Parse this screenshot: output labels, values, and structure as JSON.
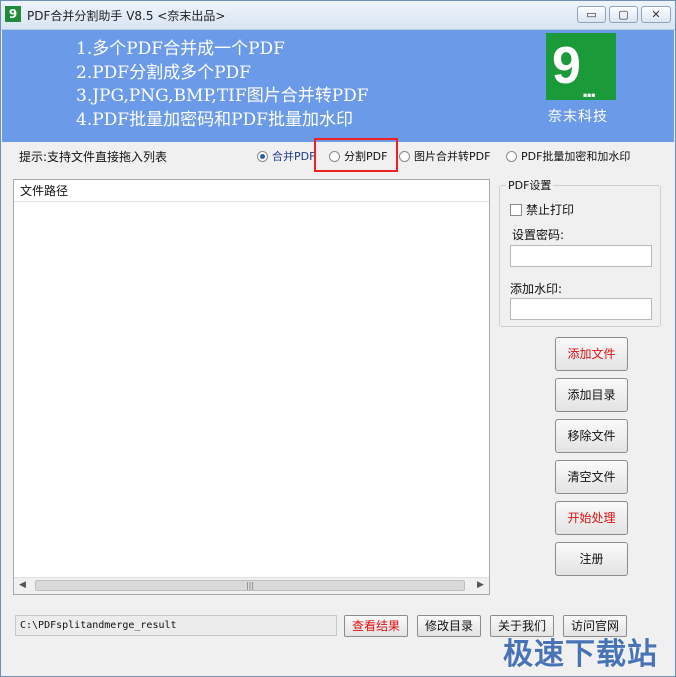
{
  "window": {
    "title": "PDF合并分割助手 V8.5 <奈末出品>",
    "app_icon_glyph": "9",
    "controls": {
      "minimize": "▭",
      "restore": "▢",
      "close": "✕"
    }
  },
  "banner": {
    "features": [
      "1.多个PDF合并成一个PDF",
      "2.PDF分割成多个PDF",
      "3.JPG,PNG,BMP,TIF图片合并转PDF",
      "4.PDF批量加密码和PDF批量加水印"
    ],
    "logo_glyph": "9",
    "logo_dots": "...",
    "brand": "奈末科技",
    "background_color": "#6b9be8",
    "logo_color": "#1b9a3a"
  },
  "hint": "提示:支持文件直接拖入列表",
  "modes": [
    {
      "label": "合并PDF",
      "selected": true
    },
    {
      "label": "分割PDF",
      "selected": false
    },
    {
      "label": "图片合并转PDF",
      "selected": false
    },
    {
      "label": "PDF批量加密和加水印",
      "selected": false
    }
  ],
  "file_list": {
    "column_header": "文件路径",
    "rows": [],
    "scroll_left": "◀",
    "scroll_right": "▶",
    "scroll_grip": "|||"
  },
  "pdf_settings": {
    "legend": "PDF设置",
    "no_print_label": "禁止打印",
    "no_print_checked": false,
    "password_label": "设置密码:",
    "password_value": "",
    "watermark_label": "添加水印:",
    "watermark_value": ""
  },
  "actions": {
    "add_file": "添加文件",
    "add_folder": "添加目录",
    "remove_file": "移除文件",
    "clear_files": "清空文件",
    "start": "开始处理",
    "register": "注册"
  },
  "output": {
    "path": "C:\\PDFsplitandmerge_result",
    "view_result": "查看结果",
    "change_dir": "修改目录",
    "about": "关于我们",
    "website": "访问官网"
  },
  "watermark_text": "极速下载站",
  "colors": {
    "accent_red": "#dd1111",
    "highlight_box": "#ee2222"
  }
}
